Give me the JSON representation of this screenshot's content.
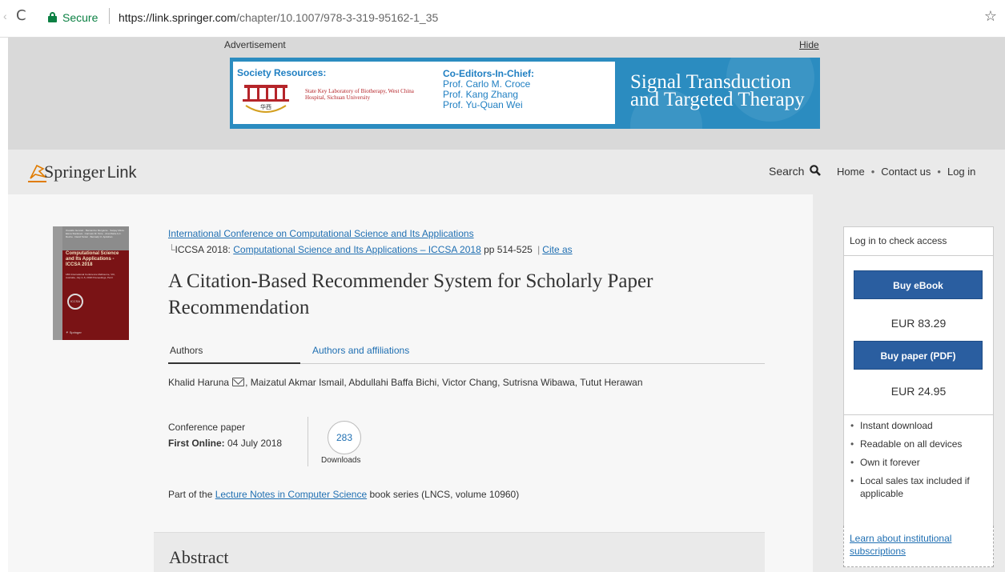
{
  "browser": {
    "secure_label": "Secure",
    "url_scheme_host": "https://link.springer.com",
    "url_path": "/chapter/10.1007/978-3-319-95162-1_35"
  },
  "ad": {
    "label": "Advertisement",
    "hide": "Hide",
    "society_resources": "Society Resources:",
    "lab_text": "State Key Laboratory of Biotherapy, West China Hospital, Sichuan University",
    "co_editors_title": "Co-Editors-In-Chief:",
    "editor_1": "Prof. Carlo M. Croce",
    "editor_2": "Prof. Kang Zhang",
    "editor_3": "Prof. Yu-Quan Wei",
    "journal": "Signal Transduction and Targeted Therapy"
  },
  "header": {
    "logo_springer": "Springer",
    "logo_link": "Link",
    "search": "Search",
    "nav": [
      "Home",
      "Contact us",
      "Log in"
    ]
  },
  "paper": {
    "conference_link": "International Conference on Computational Science and Its Applications",
    "conf_prefix": "ICCSA 2018: ",
    "proceedings_link": "Computational Science and Its Applications – ICCSA 2018",
    "pages": " pp 514-525 ",
    "cite_as": "Cite as",
    "title": "A Citation-Based Recommender System for Scholarly Paper Recommendation",
    "tab_authors": "Authors",
    "tab_affiliations": "Authors and affiliations",
    "first_author": "Khalid Haruna",
    "other_authors": ", Maizatul Akmar Ismail, Abdullahi Baffa Bichi, Victor Chang, Sutrisna Wibawa, Tutut Herawan",
    "type": "Conference paper",
    "first_online_label": "First Online:",
    "first_online_date": " 04 July 2018",
    "downloads_count": "283",
    "downloads_label": "Downloads",
    "series_prefix": "Part of the ",
    "series_link": "Lecture Notes in Computer Science",
    "series_suffix": " book series (LNCS, volume 10960)",
    "abstract_heading": "Abstract"
  },
  "cover": {
    "title": "Computational Science and Its Applications - ICCSA 2018"
  },
  "sidebar": {
    "access_header": "Log in to check access",
    "buy_ebook": "Buy eBook",
    "ebook_price": "EUR 83.29",
    "buy_pdf": "Buy paper (PDF)",
    "pdf_price": "EUR 24.95",
    "benefits": [
      "Instant download",
      "Readable on all devices",
      "Own it forever",
      "Local sales tax included if applicable"
    ],
    "institutional_link": "Learn about institutional subscriptions"
  },
  "colors": {
    "link": "#1f6fb2",
    "buy_button": "#2a5ea0",
    "ad_blue": "#2b8cc0",
    "secure_green": "#0b8043"
  }
}
